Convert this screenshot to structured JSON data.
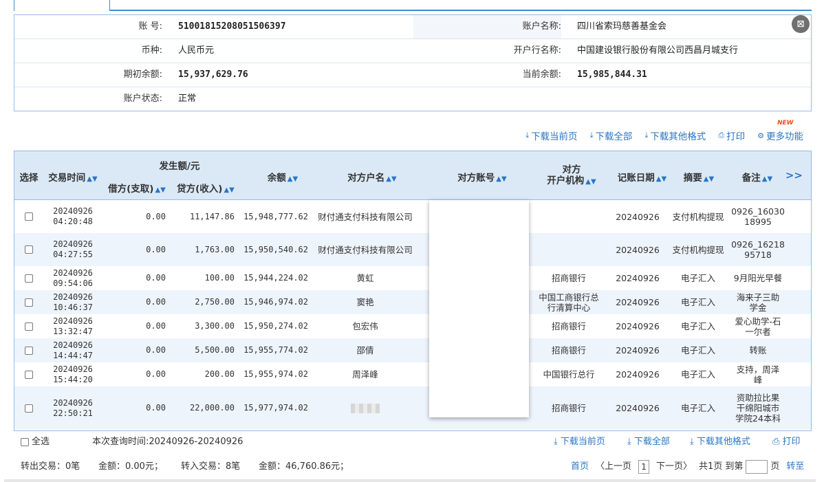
{
  "account": {
    "acct_no_label": "账      号:",
    "acct_no": "51001815208051506397",
    "acct_name_label": "账户名称:",
    "acct_name": "四川省索玛慈善基金会",
    "currency_label": "币种:",
    "currency": "人民币元",
    "bank_label": "开户行名称:",
    "bank": "中国建设银行股份有限公司西昌月城支行",
    "opening_label": "期初余额:",
    "opening": "15,937,629.76",
    "current_label": "当前余额:",
    "current": "15,985,844.31",
    "status_label": "账户状态:",
    "status": "正常"
  },
  "toolbar": {
    "download_current": "下载当前页",
    "download_all": "下载全部",
    "download_other": "下载其他格式",
    "print": "打印",
    "more": "更多功能",
    "new_badge": "NEW"
  },
  "headers": {
    "select": "选择",
    "time": "交易时间",
    "amount_group": "发生额/元",
    "debit": "借方(支取)",
    "credit": "贷方(收入)",
    "balance": "余额",
    "cp_name": "对方户名",
    "cp_acct": "对方账号",
    "cp_bank_1": "对方",
    "cp_bank_2": "开户机构",
    "book_date": "记账日期",
    "summary": "摘要",
    "remark": "备注",
    "more": ">>"
  },
  "rows": [
    {
      "d": "20240926",
      "t": "04:20:48",
      "debit": "0.00",
      "credit": "11,147.86",
      "balance": "15,948,777.62",
      "name": "财付通支付科技有限公司",
      "bank": "",
      "book": "20240926",
      "summary": "支付机构提现",
      "remark": "0926_16030 18995"
    },
    {
      "d": "20240926",
      "t": "04:27:55",
      "debit": "0.00",
      "credit": "1,763.00",
      "balance": "15,950,540.62",
      "name": "财付通支付科技有限公司",
      "bank": "",
      "book": "20240926",
      "summary": "支付机构提现",
      "remark": "0926_16218 95718"
    },
    {
      "d": "20240926",
      "t": "09:54:06",
      "debit": "0.00",
      "credit": "100.00",
      "balance": "15,944,224.02",
      "name": "黄虹",
      "bank": "招商银行",
      "book": "20240926",
      "summary": "电子汇入",
      "remark": "9月阳光早餐"
    },
    {
      "d": "20240926",
      "t": "10:46:37",
      "debit": "0.00",
      "credit": "2,750.00",
      "balance": "15,946,974.02",
      "name": "窦艳",
      "bank": "中国工商银行总行清算中心",
      "book": "20240926",
      "summary": "电子汇入",
      "remark": "海来子三助学金"
    },
    {
      "d": "20240926",
      "t": "13:32:47",
      "debit": "0.00",
      "credit": "3,300.00",
      "balance": "15,950,274.02",
      "name": "包宏伟",
      "bank": "招商银行",
      "book": "20240926",
      "summary": "电子汇入",
      "remark": "爱心助学-石一尔者"
    },
    {
      "d": "20240926",
      "t": "14:44:47",
      "debit": "0.00",
      "credit": "5,500.00",
      "balance": "15,955,774.02",
      "name": "邵倩",
      "bank": "招商银行",
      "book": "20240926",
      "summary": "电子汇入",
      "remark": "转账"
    },
    {
      "d": "20240926",
      "t": "15:44:20",
      "debit": "0.00",
      "credit": "200.00",
      "balance": "15,955,974.02",
      "name": "周泽峰",
      "bank": "中国银行总行",
      "book": "20240926",
      "summary": "电子汇入",
      "remark": "支持，周泽峰"
    },
    {
      "d": "20240926",
      "t": "22:50:21",
      "debit": "0.00",
      "credit": "22,000.00",
      "balance": "15,977,974.02",
      "name": "",
      "bank": "招商银行",
      "book": "20240926",
      "summary": "电子汇入",
      "remark": "资助拉比果干绵阳城市学院24本科"
    }
  ],
  "footer": {
    "select_all": "全选",
    "query_time": "本次查询时间:20240926-20240926",
    "download_current": "下载当前页",
    "download_all": "下载全部",
    "download_other": "下载其他格式",
    "print": "打印",
    "out_tx": "转出交易：0笔",
    "out_amt": "金额：0.00元；",
    "in_tx": "转入交易：8笔",
    "in_amt": "金额：46,760.86元；",
    "first": "首页",
    "prev": "〈上一页",
    "page": "1",
    "next": "下一页〉",
    "total": "共1页",
    "goto_pre": "到第",
    "goto_post": "页",
    "go": "转至"
  }
}
